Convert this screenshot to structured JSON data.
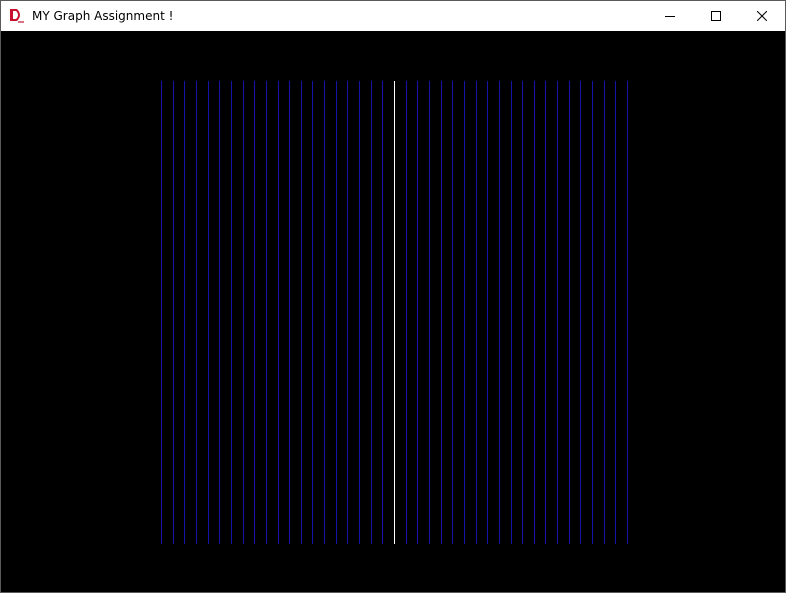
{
  "window": {
    "title": "MY Graph Assignment !",
    "app_icon": "app-logo-icon",
    "controls": {
      "minimize_icon": "minimize-icon",
      "maximize_icon": "maximize-icon",
      "close_icon": "close-icon"
    }
  },
  "canvas": {
    "background_color": "#000000",
    "line_color": "#1414a8",
    "center_line_color": "#ffffff",
    "line_count": 41,
    "center_index": 20
  },
  "colors": {
    "logo_red": "#c8102e",
    "titlebar_bg": "#ffffff"
  }
}
